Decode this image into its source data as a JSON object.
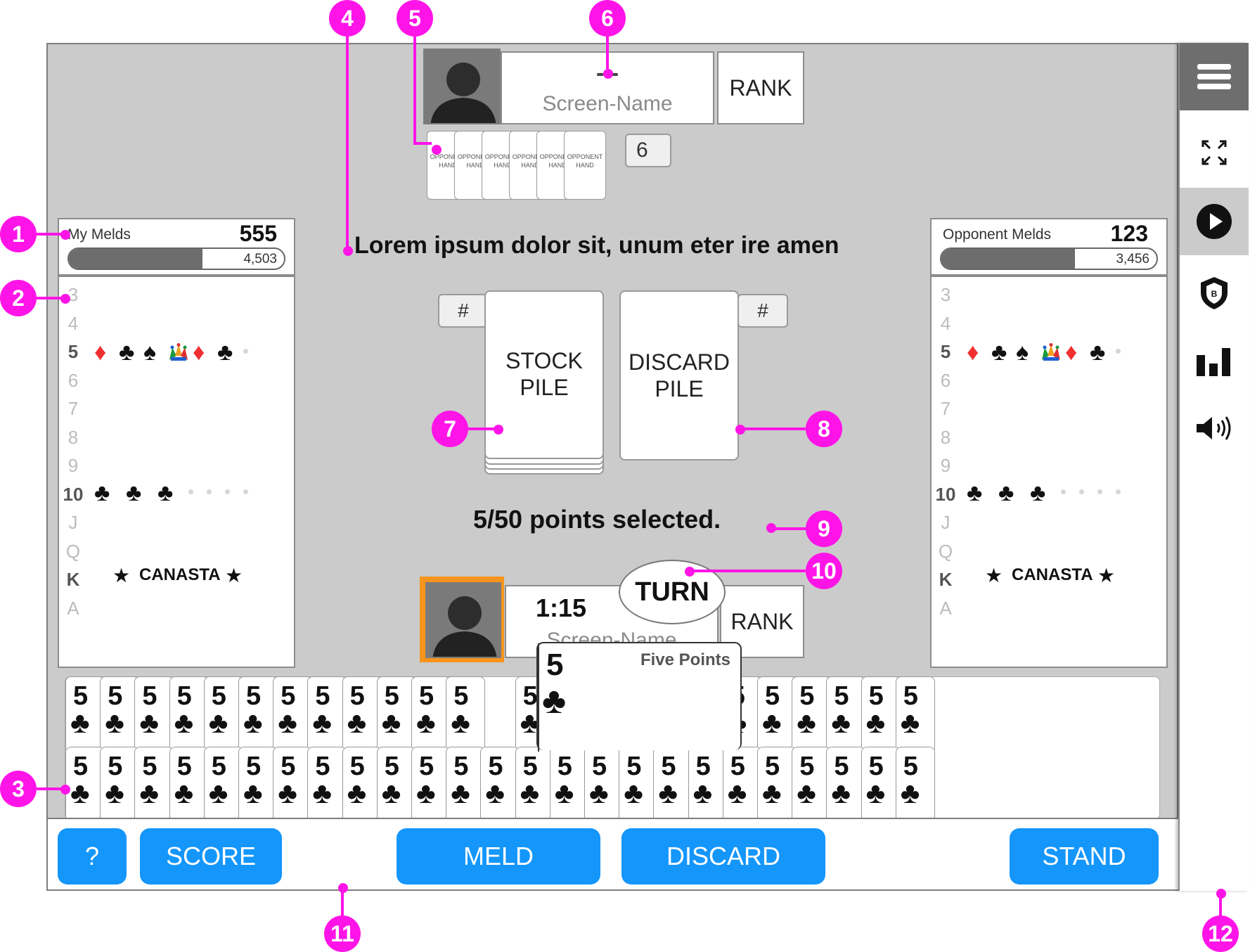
{
  "opponent": {
    "name_dashes": "- -",
    "screen_name": "Screen-Name",
    "rank": "RANK",
    "hand_count": "6",
    "hand_cards": [
      "OPPONENT HAND",
      "OPPONENT HAND",
      "OPPONENT HAND",
      "OPPONENT HAND",
      "OPPONENT HAND",
      "OPPONENT HAND"
    ]
  },
  "message": "Lorem ipsum dolor sit, unum eter ire amen",
  "stock": {
    "label_line1": "STOCK",
    "label_line2": "PILE",
    "count": "#"
  },
  "discard": {
    "label_line1": "DISCARD",
    "label_line2": "PILE",
    "count": "#"
  },
  "points_selected": "5/50 points selected.",
  "player": {
    "timer": "1:15",
    "screen_name": "Screen-Name",
    "rank": "RANK",
    "turn": "TURN"
  },
  "tooltip": {
    "rank": "5",
    "suit": "♣",
    "text": "Five Points"
  },
  "my_melds": {
    "title": "My Melds",
    "score": "555",
    "progress_value": "4,503",
    "progress_fraction": 0.62
  },
  "opp_melds": {
    "title": "Opponent Melds",
    "score": "123",
    "progress_value": "3,456",
    "progress_fraction": 0.62
  },
  "meld_rows": [
    "3",
    "4",
    "5",
    "6",
    "7",
    "8",
    "9",
    "10",
    "J",
    "Q",
    "K",
    "A"
  ],
  "canasta": "CANASTA",
  "star": "★",
  "hand_card": {
    "rank": "5",
    "suit": "♣"
  },
  "buttons": {
    "help": "?",
    "score": "SCORE",
    "meld": "MELD",
    "discard": "DISCARD",
    "stand": "STAND"
  },
  "callouts": [
    "1",
    "2",
    "3",
    "4",
    "5",
    "6",
    "7",
    "8",
    "9",
    "10",
    "11",
    "12"
  ],
  "colors": {
    "accent_blue": "#1496fb",
    "callout_pink": "#ff14e8",
    "board_gray": "#cbcbcb",
    "turn_highlight": "#f7941d"
  },
  "sidebar_icons": [
    "menu-icon",
    "fullscreen-icon",
    "play-icon",
    "badge-icon",
    "stats-icon",
    "volume-icon"
  ]
}
